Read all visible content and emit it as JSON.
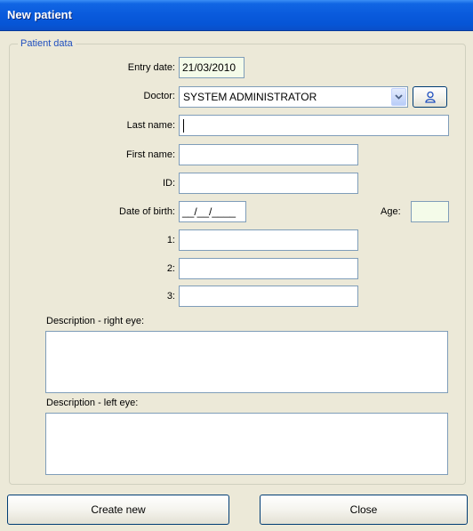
{
  "window": {
    "title": "New patient"
  },
  "group": {
    "legend": "Patient data"
  },
  "form": {
    "entry_date_label": "Entry date:",
    "entry_date_value": "21/03/2010",
    "doctor_label": "Doctor:",
    "doctor_value": "SYSTEM ADMINISTRATOR",
    "last_name_label": "Last name:",
    "last_name_value": "",
    "first_name_label": "First name:",
    "first_name_value": "",
    "id_label": "ID:",
    "id_value": "",
    "dob_label": "Date of birth:",
    "dob_value": "__/__/____",
    "age_label": "Age:",
    "age_value": "",
    "field1_label": "1:",
    "field2_label": "2:",
    "field3_label": "3:",
    "desc_right_label": "Description - right eye:",
    "desc_left_label": "Description - left eye:"
  },
  "buttons": {
    "create_label": "Create new",
    "close_label": "Close"
  },
  "icons": {
    "doctor_button": "person-icon",
    "combo_arrow": "chevron-down-icon"
  },
  "colors": {
    "title_bar": "#0a5bdd",
    "accent_text": "#1f4fbf",
    "readonly_bg": "#f4fbe9"
  }
}
